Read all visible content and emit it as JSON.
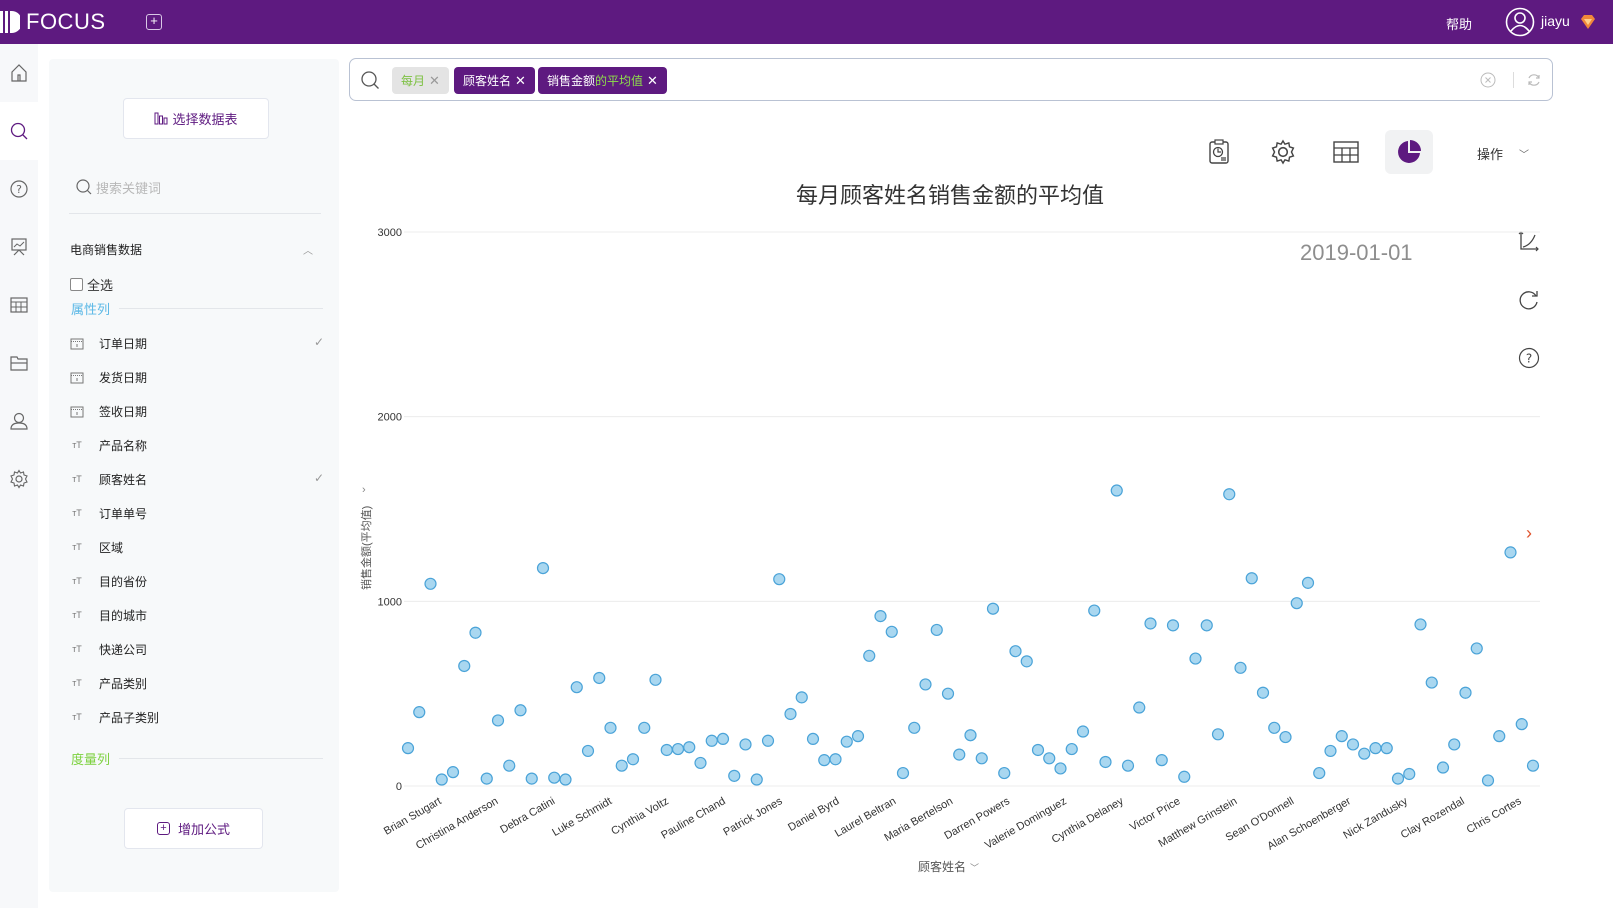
{
  "app": {
    "brand": "FOCUS",
    "help_label": "帮助",
    "username": "jiayu"
  },
  "left_nav": [
    {
      "icon": "home-icon"
    },
    {
      "icon": "search-icon",
      "active": true
    },
    {
      "icon": "help-circle-icon"
    },
    {
      "icon": "presentation-icon"
    },
    {
      "icon": "table-icon"
    },
    {
      "icon": "folder-icon"
    },
    {
      "icon": "user-icon"
    },
    {
      "icon": "gear-icon"
    }
  ],
  "side_panel": {
    "choose_table_label": "选择数据表",
    "search_placeholder": "搜索关键词",
    "dataset_title": "电商销售数据",
    "select_all_label": "全选",
    "attr_section_label": "属性列",
    "measure_section_label": "度量列",
    "add_formula_label": "增加公式",
    "fields": [
      {
        "type": "date",
        "label": "订单日期",
        "checked": true
      },
      {
        "type": "date",
        "label": "发货日期",
        "checked": false
      },
      {
        "type": "date",
        "label": "签收日期",
        "checked": false
      },
      {
        "type": "text",
        "label": "产品名称",
        "checked": false
      },
      {
        "type": "text",
        "label": "顾客姓名",
        "checked": true
      },
      {
        "type": "text",
        "label": "订单单号",
        "checked": false
      },
      {
        "type": "text",
        "label": "区域",
        "checked": false
      },
      {
        "type": "text",
        "label": "目的省份",
        "checked": false
      },
      {
        "type": "text",
        "label": "目的城市",
        "checked": false
      },
      {
        "type": "text",
        "label": "快递公司",
        "checked": false
      },
      {
        "type": "text",
        "label": "产品类别",
        "checked": false
      },
      {
        "type": "text",
        "label": "产品子类别",
        "checked": false
      }
    ]
  },
  "search": {
    "tokens": [
      {
        "text": "每月",
        "style": "plain"
      },
      {
        "text": "顾客姓名",
        "style": "column"
      },
      {
        "text_main": "销售金额",
        "text_highlight": "的平均值",
        "style": "measure"
      }
    ]
  },
  "toolbar": {
    "ops_label": "操作",
    "buttons": [
      "report-icon",
      "settings-icon",
      "table-view-icon",
      "pie-chart-icon"
    ]
  },
  "chart_data": {
    "type": "scatter",
    "title": "每月顾客姓名销售金额的平均值",
    "animation_frame_label": "2019-01-01",
    "xlabel": "顾客姓名",
    "ylabel": "销售金额(平均值)",
    "ylim": [
      0,
      3000
    ],
    "yticks": [
      0,
      1000,
      2000,
      3000
    ],
    "grid": true,
    "marker_color": "#a9d7f0",
    "marker_edge_color": "#4aa3d8",
    "x_tick_labels": [
      "Brian Stugart",
      "Christina Anderson",
      "Debra Catini",
      "Luke Schmidt",
      "Cynthia Voltz",
      "Pauline Chand",
      "Patrick Jones",
      "Daniel Byrd",
      "Laurel Beltran",
      "Maria Bertelson",
      "Darren Powers",
      "Valerie Dominguez",
      "Cynthia Delaney",
      "Victor Price",
      "Matthew Grinstein",
      "Sean O'Donnell",
      "Alan Schoenberger",
      "Nick Zandusky",
      "Clay Rozendal",
      "Chris Cortes"
    ],
    "values": [
      205,
      400,
      1095,
      35,
      75,
      650,
      830,
      40,
      355,
      110,
      410,
      40,
      1180,
      45,
      35,
      535,
      190,
      585,
      315,
      110,
      145,
      315,
      575,
      195,
      200,
      210,
      125,
      245,
      255,
      55,
      225,
      35,
      245,
      1120,
      390,
      480,
      255,
      140,
      145,
      240,
      270,
      705,
      920,
      835,
      70,
      315,
      550,
      845,
      500,
      170,
      275,
      150,
      960,
      70,
      730,
      675,
      195,
      150,
      95,
      200,
      295,
      950,
      130,
      1600,
      110,
      425,
      880,
      140,
      870,
      50,
      690,
      870,
      280,
      1580,
      640,
      1125,
      505,
      315,
      265,
      990,
      1100,
      70,
      190,
      270,
      225,
      175,
      205,
      205,
      40,
      65,
      875,
      560,
      100,
      225,
      505,
      745,
      30,
      270,
      1265,
      335,
      110
    ]
  }
}
